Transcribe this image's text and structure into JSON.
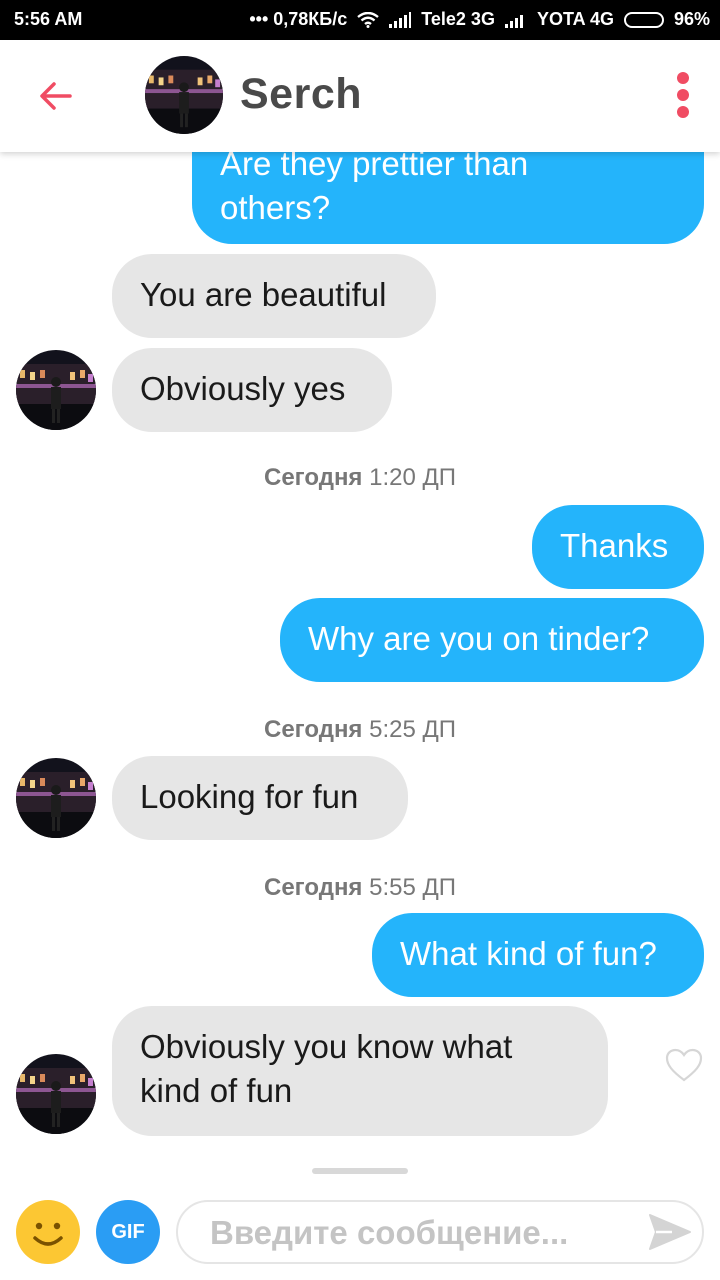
{
  "status_bar": {
    "time": "5:56 AM",
    "network_speed": "••• 0,78КБ/с",
    "carrier1": "Tele2 3G",
    "carrier2": "YOTA 4G",
    "battery": "96%",
    "battery_level": 0.96
  },
  "header": {
    "contact_name": "Serch",
    "back_icon": "arrow-left-icon",
    "menu_icon": "more-vertical-icon",
    "accent_color": "#f04c63"
  },
  "messages": [
    {
      "direction": "out",
      "text_line1": "Are they prettier than",
      "text_line2": "others?"
    },
    {
      "direction": "in",
      "text": "You are beautiful"
    },
    {
      "direction": "in",
      "text": "Obviously yes"
    },
    {
      "direction": "out",
      "text": "Thanks"
    },
    {
      "direction": "out",
      "text": "Why are you on tinder?"
    },
    {
      "direction": "in",
      "text": "Looking for fun"
    },
    {
      "direction": "out",
      "text": "What kind of fun?"
    },
    {
      "direction": "in",
      "text_line1": "Obviously you know what",
      "text_line2": "kind of fun"
    }
  ],
  "timestamps": [
    {
      "day": "Сегодня",
      "time": "1:20 ДП"
    },
    {
      "day": "Сегодня",
      "time": "5:25 ДП"
    },
    {
      "day": "Сегодня",
      "time": "5:55 ДП"
    }
  ],
  "composer": {
    "placeholder": "Введите сообщение...",
    "gif_label": "GIF",
    "emoji_icon": "smiley-icon",
    "send_icon": "send-icon"
  },
  "colors": {
    "outgoing_bubble": "#24b4fb",
    "incoming_bubble": "#e6e6e6"
  }
}
